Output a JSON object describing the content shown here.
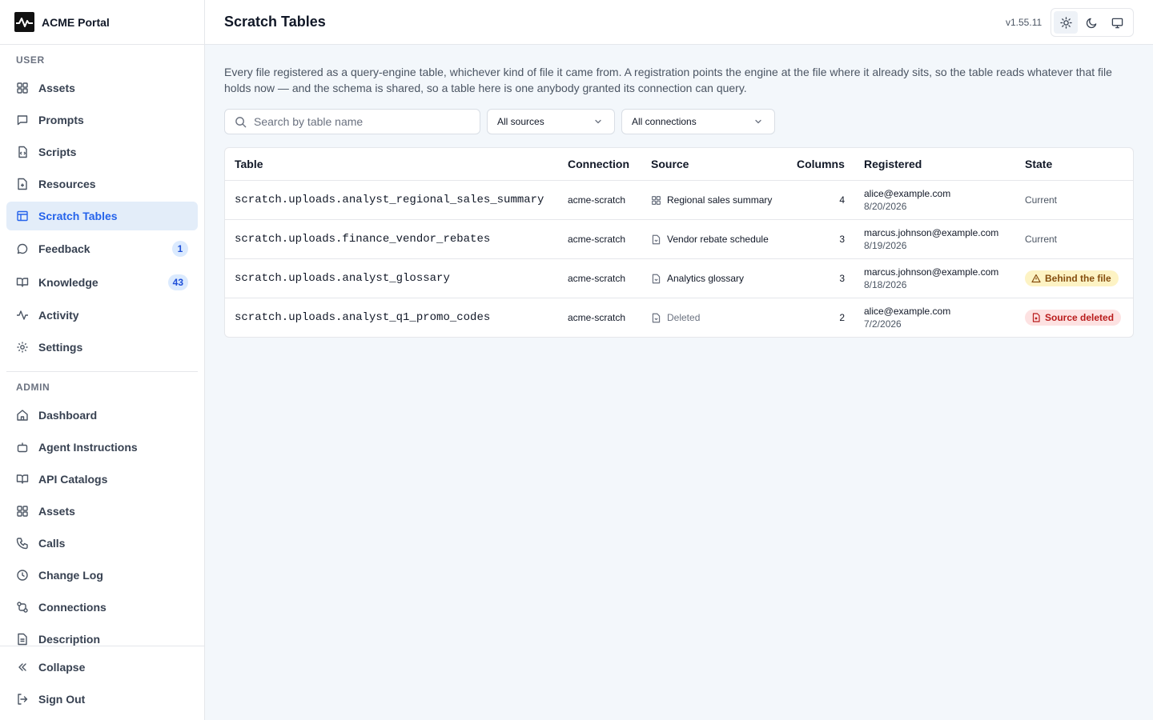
{
  "brand": {
    "name": "ACME Portal"
  },
  "sidebar": {
    "user_label": "USER",
    "user_items": [
      {
        "label": "Assets",
        "icon": "grid-icon"
      },
      {
        "label": "Prompts",
        "icon": "message-square-icon"
      },
      {
        "label": "Scripts",
        "icon": "code-icon"
      },
      {
        "label": "Resources",
        "icon": "file-plus-icon"
      },
      {
        "label": "Scratch Tables",
        "icon": "table-icon",
        "active": true
      },
      {
        "label": "Feedback",
        "icon": "message-circle-icon",
        "badge": "1"
      },
      {
        "label": "Knowledge",
        "icon": "book-open-icon",
        "badge": "43"
      },
      {
        "label": "Activity",
        "icon": "activity-icon"
      },
      {
        "label": "Settings",
        "icon": "gear-icon"
      }
    ],
    "admin_label": "ADMIN",
    "admin_items": [
      {
        "label": "Dashboard",
        "icon": "home-icon"
      },
      {
        "label": "Agent Instructions",
        "icon": "bot-icon"
      },
      {
        "label": "API Catalogs",
        "icon": "book-open-icon"
      },
      {
        "label": "Assets",
        "icon": "grid-icon"
      },
      {
        "label": "Calls",
        "icon": "phone-icon"
      },
      {
        "label": "Change Log",
        "icon": "clock-icon"
      },
      {
        "label": "Connections",
        "icon": "plug-icon"
      },
      {
        "label": "Description",
        "icon": "file-text-icon"
      }
    ],
    "footer": {
      "collapse": "Collapse",
      "sign_out": "Sign Out"
    }
  },
  "header": {
    "title": "Scratch Tables",
    "version": "v1.55.11"
  },
  "main": {
    "description": "Every file registered as a query-engine table, whichever kind of file it came from. A registration points the engine at the file where it already sits, so the table reads whatever that file holds now — and the schema is shared, so a table here is one anybody granted its connection can query.",
    "search_placeholder": "Search by table name",
    "filter_sources": "All sources",
    "filter_connections": "All connections"
  },
  "table": {
    "headers": {
      "table": "Table",
      "connection": "Connection",
      "source": "Source",
      "columns": "Columns",
      "registered": "Registered",
      "state": "State"
    },
    "rows": [
      {
        "table": "scratch.uploads.analyst_regional_sales_summary",
        "connection": "acme-scratch",
        "source": "Regional sales summary",
        "source_icon": "grid-icon",
        "columns": "4",
        "registered_by": "alice@example.com",
        "registered_on": "8/20/2026",
        "state": "Current",
        "state_kind": "plain"
      },
      {
        "table": "scratch.uploads.finance_vendor_rebates",
        "connection": "acme-scratch",
        "source": "Vendor rebate schedule",
        "source_icon": "file-icon",
        "columns": "3",
        "registered_by": "marcus.johnson@example.com",
        "registered_on": "8/19/2026",
        "state": "Current",
        "state_kind": "plain"
      },
      {
        "table": "scratch.uploads.analyst_glossary",
        "connection": "acme-scratch",
        "source": "Analytics glossary",
        "source_icon": "file-icon",
        "columns": "3",
        "registered_by": "marcus.johnson@example.com",
        "registered_on": "8/18/2026",
        "state": "Behind the file",
        "state_kind": "warning"
      },
      {
        "table": "scratch.uploads.analyst_q1_promo_codes",
        "connection": "acme-scratch",
        "source": "Deleted",
        "source_icon": "file-icon",
        "columns": "2",
        "registered_by": "alice@example.com",
        "registered_on": "7/2/2026",
        "state": "Source deleted",
        "state_kind": "danger"
      }
    ]
  },
  "colors": {
    "accent": "#2563eb",
    "active_bg": "#e3edf9",
    "warning_bg": "#fdf3c4",
    "danger_bg": "#fde2e2"
  }
}
